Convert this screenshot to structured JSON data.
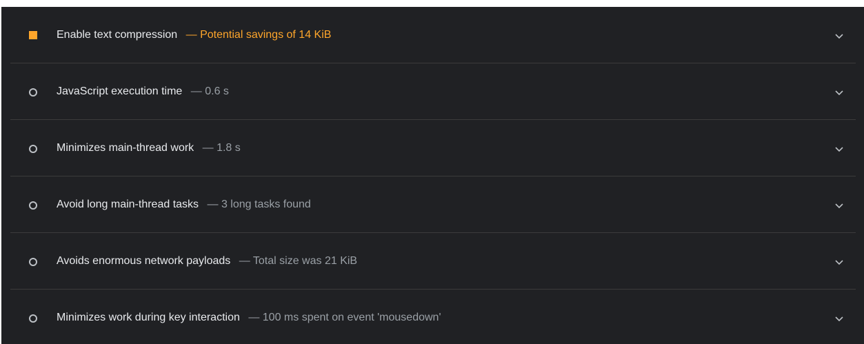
{
  "audits": [
    {
      "title": "Enable text compression",
      "separator": "—",
      "value": "Potential savings of 14 KiB",
      "status_icon": "warning-square-icon",
      "status_color": "#ffa62b"
    },
    {
      "title": "JavaScript execution time",
      "separator": "—",
      "value": "0.6 s",
      "status_icon": "info-circle-icon",
      "status_color": "#bdc1c6"
    },
    {
      "title": "Minimizes main-thread work",
      "separator": "—",
      "value": "1.8 s",
      "status_icon": "info-circle-icon",
      "status_color": "#bdc1c6"
    },
    {
      "title": "Avoid long main-thread tasks",
      "separator": "—",
      "value": "3 long tasks found",
      "status_icon": "info-circle-icon",
      "status_color": "#bdc1c6"
    },
    {
      "title": "Avoids enormous network payloads",
      "separator": "—",
      "value": "Total size was 21 KiB",
      "status_icon": "info-circle-icon",
      "status_color": "#bdc1c6"
    },
    {
      "title": "Minimizes work during key interaction",
      "separator": "—",
      "value": "100 ms spent on event 'mousedown'",
      "status_icon": "info-circle-icon",
      "status_color": "#bdc1c6"
    }
  ],
  "colors": {
    "background": "#202124",
    "divider": "#3c3c3c",
    "title_text": "#e8eaed",
    "muted_text": "#9aa0a6",
    "warning": "#ffa62b"
  },
  "icons": {
    "expand": "chevron-down-icon"
  }
}
